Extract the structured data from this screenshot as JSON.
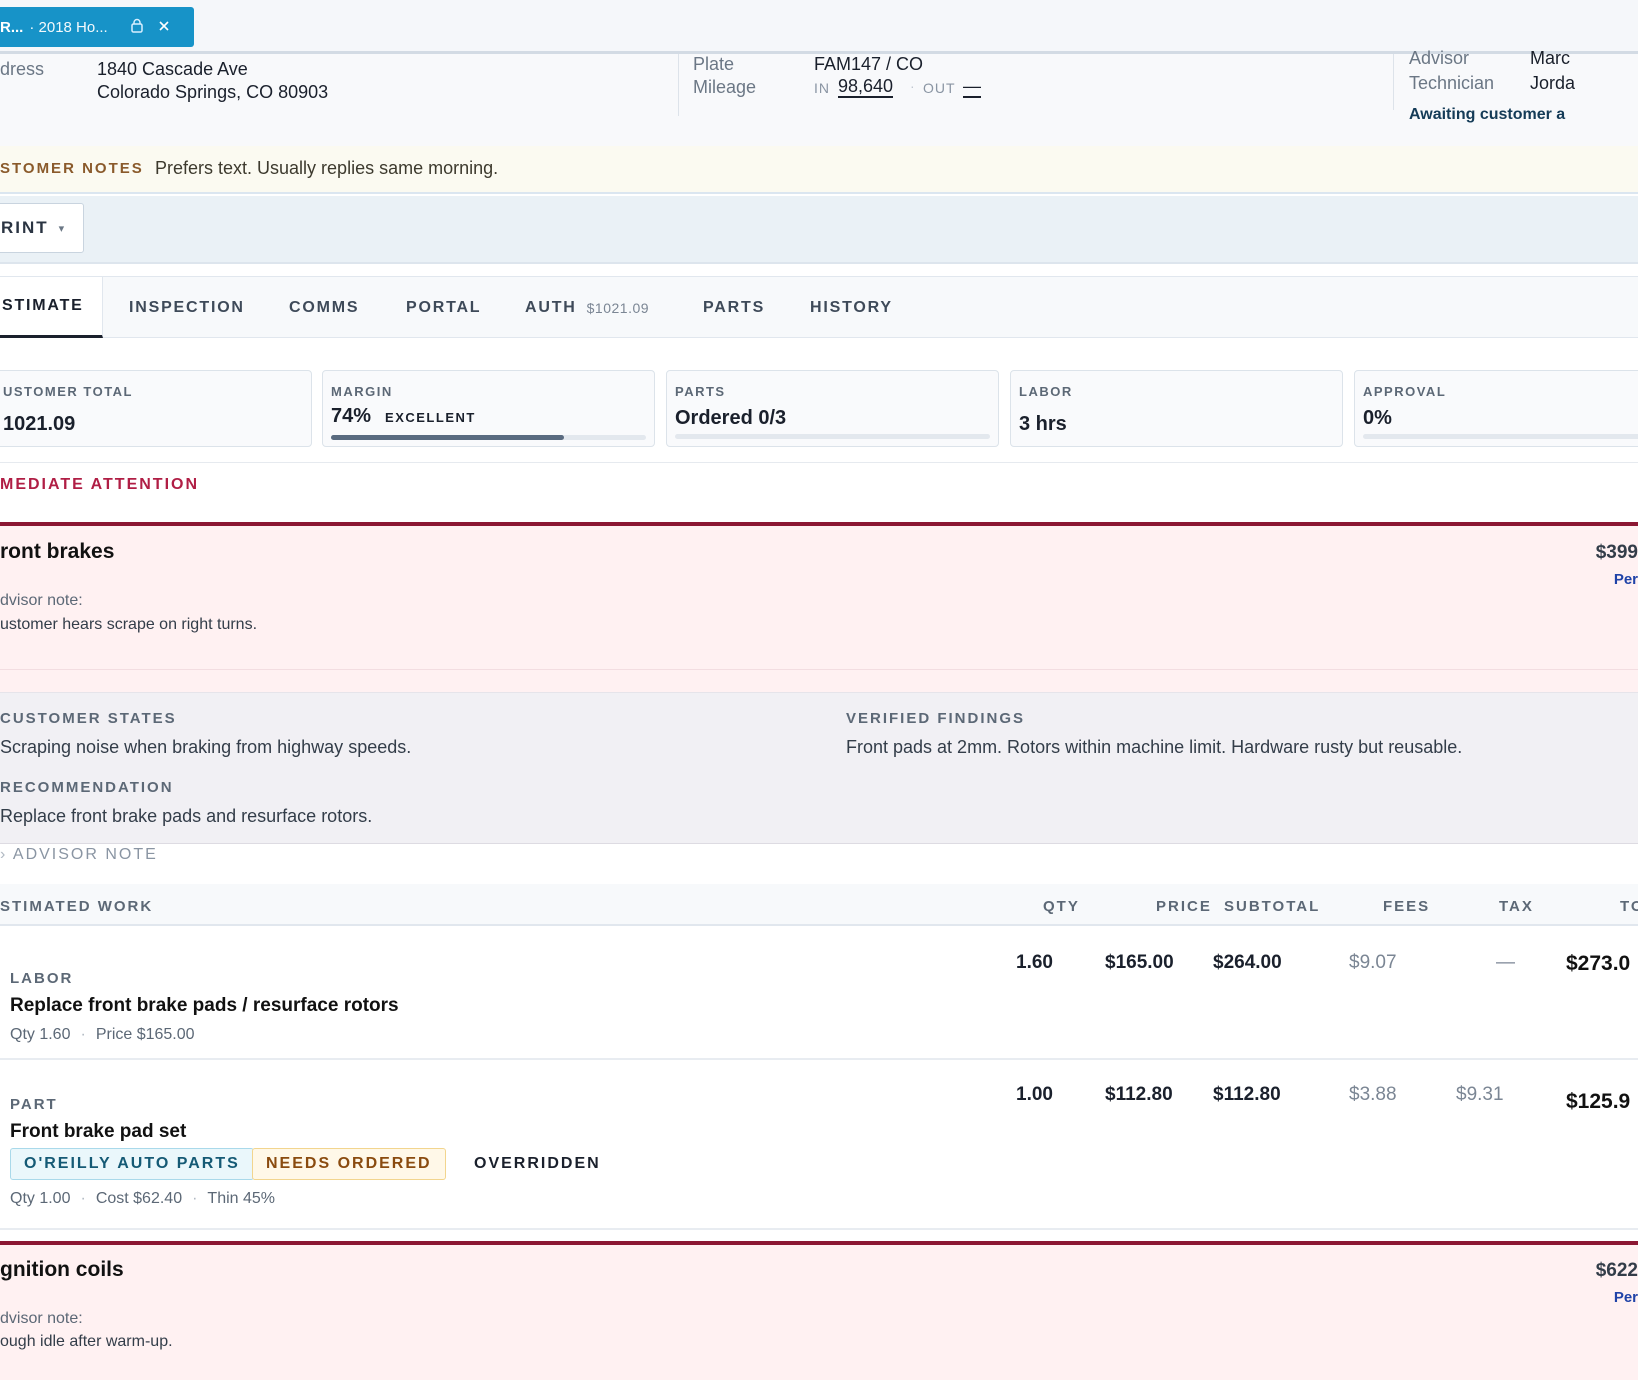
{
  "doc_tab": {
    "title": "R...",
    "subtitle": "· 2018 Ho...",
    "lock_icon": "lock-icon",
    "close_icon": "close-icon"
  },
  "info": {
    "address_label": "dress",
    "address_line1": "1840 Cascade Ave",
    "address_line2": "Colorado Springs, CO 80903",
    "plate_label": "Plate",
    "plate_value": "FAM147 / CO",
    "mileage_label": "Mileage",
    "mileage_in_label": "IN",
    "mileage_in": "98,640",
    "mileage_out_label": "OUT",
    "mileage_out": "—",
    "advisor_label": "Advisor",
    "advisor_value": "Marc",
    "technician_label": "Technician",
    "technician_value": "Jorda",
    "status": "Awaiting customer a"
  },
  "customer_notes": {
    "label": "STOMER NOTES",
    "text": "Prefers text. Usually replies same morning."
  },
  "print_button": {
    "label": "RINT",
    "caret": "▾"
  },
  "nav_tabs": [
    {
      "label": "STIMATE"
    },
    {
      "label": "INSPECTION"
    },
    {
      "label": "COMMS"
    },
    {
      "label": "PORTAL"
    },
    {
      "label": "AUTH",
      "amount": "$1021.09"
    },
    {
      "label": "PARTS"
    },
    {
      "label": "HISTORY"
    }
  ],
  "summary": {
    "customer_total_label": "USTOMER TOTAL",
    "customer_total": "1021.09",
    "margin_label": "MARGIN",
    "margin_value": "74%",
    "margin_tag": "EXCELLENT",
    "margin_fraction": 0.74,
    "parts_label": "PARTS",
    "parts_value": "Ordered 0/3",
    "parts_fraction": 0,
    "labor_label": "LABOR",
    "labor_value": "3 hrs",
    "approval_label": "APPROVAL",
    "approval_value": "0%",
    "approval_fraction": 0
  },
  "attention": {
    "label": "MEDIATE ATTENTION",
    "accent": "#8c1733"
  },
  "job1": {
    "title": "ront brakes",
    "price": "$399",
    "link": "Per",
    "advisor_note_label": "dvisor note:",
    "advisor_note": "ustomer hears scrape on right turns."
  },
  "findings": {
    "customer_states_label": "CUSTOMER STATES",
    "customer_states": "Scraping noise when braking from highway speeds.",
    "verified_label": "VERIFIED FINDINGS",
    "verified": "Front pads at 2mm. Rotors within machine limit. Hardware rusty but reusable.",
    "recommendation_label": "RECOMMENDATION",
    "recommendation": "Replace front brake pads and resurface rotors."
  },
  "advisor_note_toggle": "ADVISOR NOTE",
  "work_table": {
    "headers": {
      "work": "STIMATED WORK",
      "qty": "QTY",
      "price": "PRICE",
      "subtotal": "SUBTOTAL",
      "fees": "FEES",
      "tax": "TAX",
      "total": "TO"
    },
    "rows": [
      {
        "type": "LABOR",
        "name": "Replace front brake pads / resurface rotors",
        "meta1": "Qty 1.60",
        "meta2": "Price $165.00",
        "qty": "1.60",
        "price": "$165.00",
        "subtotal": "$264.00",
        "fees": "$9.07",
        "tax": "—",
        "total": "$273.0"
      },
      {
        "type": "PART",
        "name": "Front brake pad set",
        "vendor": "O'REILLY AUTO PARTS",
        "status": "NEEDS ORDERED",
        "flag": "OVERRIDDEN",
        "meta1": "Qty 1.00",
        "meta2": "Cost $62.40",
        "meta3": "Thin 45%",
        "qty": "1.00",
        "price": "$112.80",
        "subtotal": "$112.80",
        "fees": "$3.88",
        "tax": "$9.31",
        "total": "$125.9"
      }
    ]
  },
  "job2": {
    "title": "gnition coils",
    "price": "$622",
    "link": "Per",
    "advisor_note_label": "dvisor note:",
    "advisor_note": "ough idle after warm-up."
  }
}
